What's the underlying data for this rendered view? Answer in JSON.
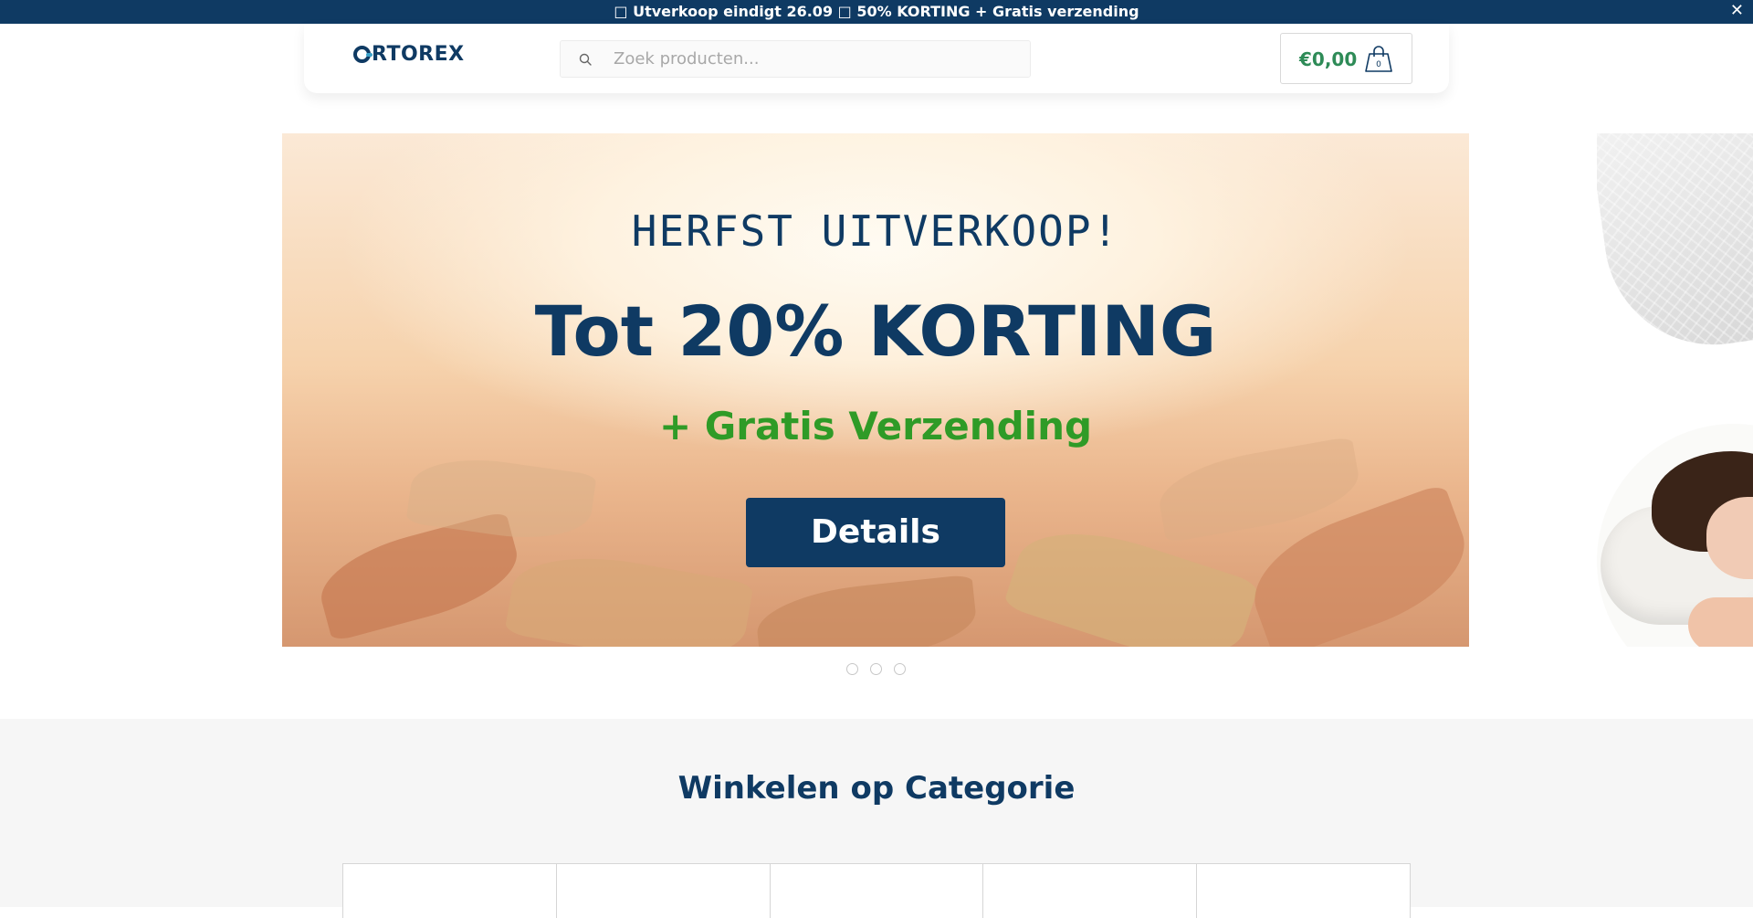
{
  "announcement": {
    "text": "□ Utverkoop eindigt 26.09 □ 50% KORTING + Gratis verzending",
    "close": "✕"
  },
  "header": {
    "logo_rest": "RTOREX",
    "search_placeholder": "Zoek producten...",
    "cart_price": "€0,00",
    "cart_count": "0"
  },
  "hero": {
    "title": "HERFST UITVERKOOP!",
    "headline": "Tot 20% KORTING",
    "subline": "+ Gratis Verzending",
    "button": "Details",
    "dots": 3
  },
  "categories": {
    "heading": "Winkelen op Categorie",
    "count": 5
  },
  "colors": {
    "brand": "#0f3a63",
    "accent_green": "#2f9b27",
    "price_green": "#2e8b57"
  },
  "icons": [
    "search-icon",
    "shopping-bag-icon",
    "close-icon"
  ]
}
